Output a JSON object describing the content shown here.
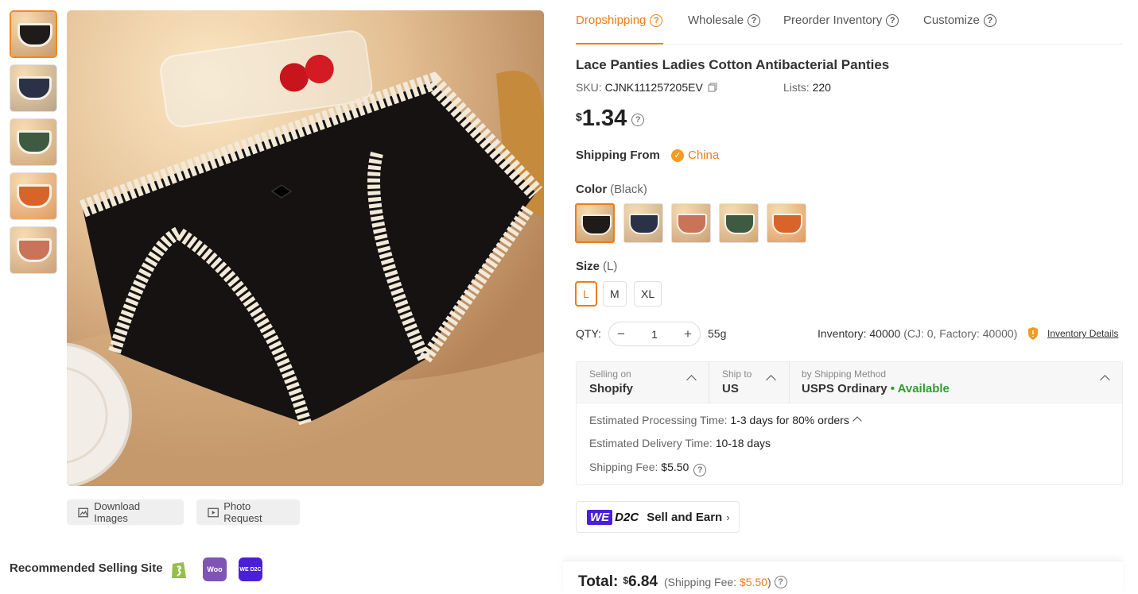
{
  "tabs": [
    {
      "label": "Dropshipping"
    },
    {
      "label": "Wholesale"
    },
    {
      "label": "Preorder Inventory"
    },
    {
      "label": "Customize"
    }
  ],
  "product": {
    "title": "Lace Panties Ladies Cotton Antibacterial Panties",
    "sku_label": "SKU:",
    "sku": "CJNK111257205EV",
    "lists_label": "Lists:",
    "lists": "220",
    "currency": "$",
    "price": "1.34"
  },
  "shipping_from": {
    "label": "Shipping From",
    "value": "China"
  },
  "color": {
    "label": "Color",
    "selected": "(Black)",
    "swatches": [
      {
        "name": "black",
        "color": "#1e1b18",
        "bg": "#c79a6a"
      },
      {
        "name": "navy",
        "color": "#2b3247",
        "bg": "#c5a684"
      },
      {
        "name": "coral",
        "color": "#c97458",
        "bg": "#caa07a"
      },
      {
        "name": "green",
        "color": "#3e5a40",
        "bg": "#cda67a"
      },
      {
        "name": "orange",
        "color": "#d9642a",
        "bg": "#e09a60"
      }
    ]
  },
  "size": {
    "label": "Size",
    "selected": "(L)",
    "options": [
      "L",
      "M",
      "XL"
    ]
  },
  "qty": {
    "label": "QTY:",
    "minus": "−",
    "plus": "+",
    "value": "1",
    "weight": "55g"
  },
  "inventory": {
    "text": "Inventory: 40000",
    "sub": "(CJ: 0, Factory: 40000)",
    "details_link": "Inventory Details"
  },
  "shipping_box": {
    "selling_on_label": "Selling on",
    "selling_on": "Shopify",
    "ship_to_label": "Ship to",
    "ship_to": "US",
    "method_label": "by Shipping Method",
    "method": "USPS Ordinary",
    "availability": "• Available",
    "processing_label": "Estimated Processing Time:",
    "processing": "1-3 days for 80% orders",
    "delivery_label": "Estimated Delivery Time:",
    "delivery": "10-18 days",
    "fee_label": "Shipping Fee:",
    "fee": "$5.50"
  },
  "d2c": {
    "we": "WE",
    "d2c": "D2C",
    "label": "Sell and Earn",
    "arrow": "›"
  },
  "total": {
    "label": "Total:",
    "currency": "$",
    "amount": "6.84",
    "shipping_prefix": "(Shipping Fee:",
    "shipping_fee": "$5.50",
    "shipping_suffix": ")"
  },
  "image_actions": {
    "download": "Download Images",
    "photo_request": "Photo Request"
  },
  "recommended": {
    "label": "Recommended Selling Site",
    "sites": [
      {
        "name": "shopify",
        "text": "",
        "color": "#95bf47"
      },
      {
        "name": "woocommerce",
        "text": "Woo",
        "color": "#7f54b3"
      },
      {
        "name": "we-d2c",
        "text": "WE D2C",
        "color": "#4b1fd8"
      }
    ]
  },
  "thumbnails": [
    {
      "color": "#1e1b18",
      "bg": "#c79a6a"
    },
    {
      "color": "#2b3247",
      "bg": "#b9a389"
    },
    {
      "color": "#3e5a40",
      "bg": "#cda67a"
    },
    {
      "color": "#d9642a",
      "bg": "#e09a60"
    },
    {
      "color": "#c97458",
      "bg": "#caa07a"
    }
  ],
  "icons": {
    "help": "?",
    "check": "✓"
  }
}
